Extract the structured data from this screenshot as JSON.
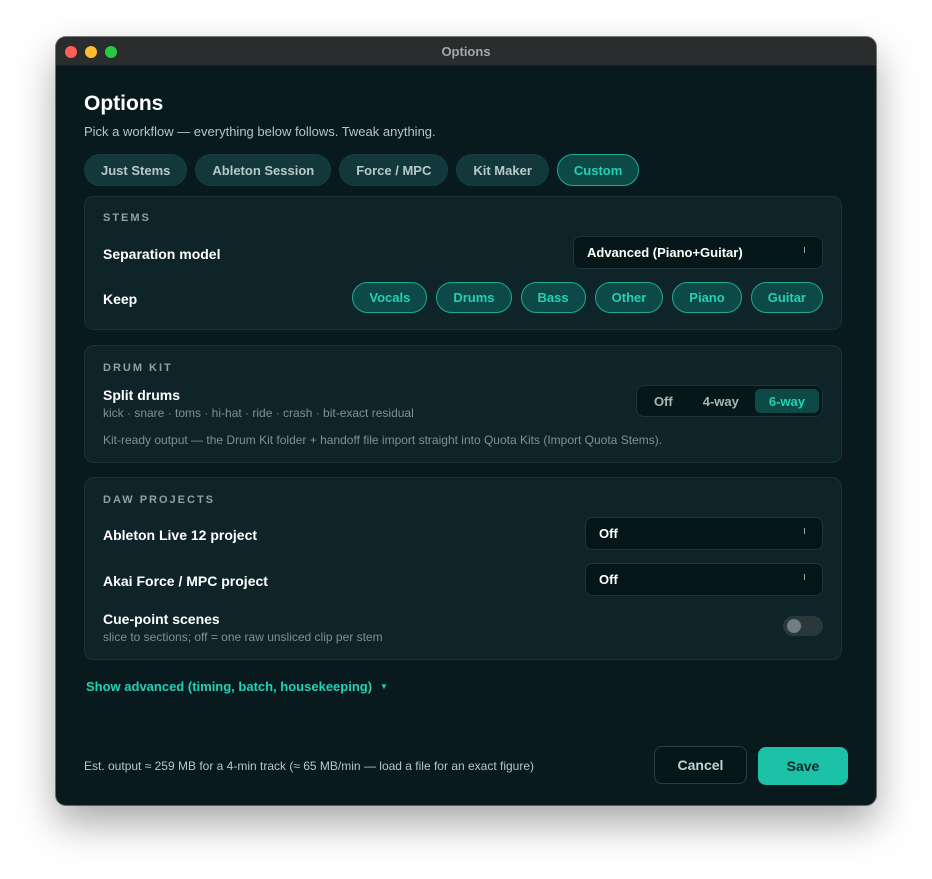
{
  "window": {
    "title": "Options"
  },
  "header": {
    "title": "Options",
    "subtitle": "Pick a workflow — everything below follows. Tweak anything."
  },
  "presets": [
    {
      "label": "Just Stems",
      "active": false
    },
    {
      "label": "Ableton Session",
      "active": false
    },
    {
      "label": "Force / MPC",
      "active": false
    },
    {
      "label": "Kit Maker",
      "active": false
    },
    {
      "label": "Custom",
      "active": true
    }
  ],
  "stems": {
    "section_label": "STEMS",
    "model_label": "Separation model",
    "model_value": "Advanced (Piano+Guitar)",
    "keep_label": "Keep",
    "keep_chips": [
      "Vocals",
      "Drums",
      "Bass",
      "Other",
      "Piano",
      "Guitar"
    ]
  },
  "drum_kit": {
    "section_label": "DRUM KIT",
    "split_label": "Split drums",
    "split_sub": "kick · snare · toms · hi-hat · ride · crash · bit-exact residual",
    "options": [
      "Off",
      "4-way",
      "6-way"
    ],
    "selected": "6-way",
    "note": "Kit-ready output — the Drum Kit folder + handoff file import straight into Quota Kits (Import Quota Stems)."
  },
  "daw": {
    "section_label": "DAW PROJECTS",
    "ableton_label": "Ableton Live 12 project",
    "ableton_value": "Off",
    "akai_label": "Akai Force / MPC project",
    "akai_value": "Off",
    "cue_label": "Cue-point scenes",
    "cue_sub": "slice to sections; off = one raw unsliced clip per stem",
    "cue_enabled": false
  },
  "advanced": {
    "label": "Show advanced (timing, batch, housekeeping)",
    "icon": "triangle-down-icon"
  },
  "footer": {
    "estimate": "Est. output ≈ 259 MB for a 4-min track (≈ 65 MB/min — load a file for an exact figure)",
    "cancel_label": "Cancel",
    "save_label": "Save"
  },
  "colors": {
    "accent": "#23d1b6",
    "background": "#081a1d",
    "card": "#0e2428",
    "save_button": "#1cc2a8"
  }
}
